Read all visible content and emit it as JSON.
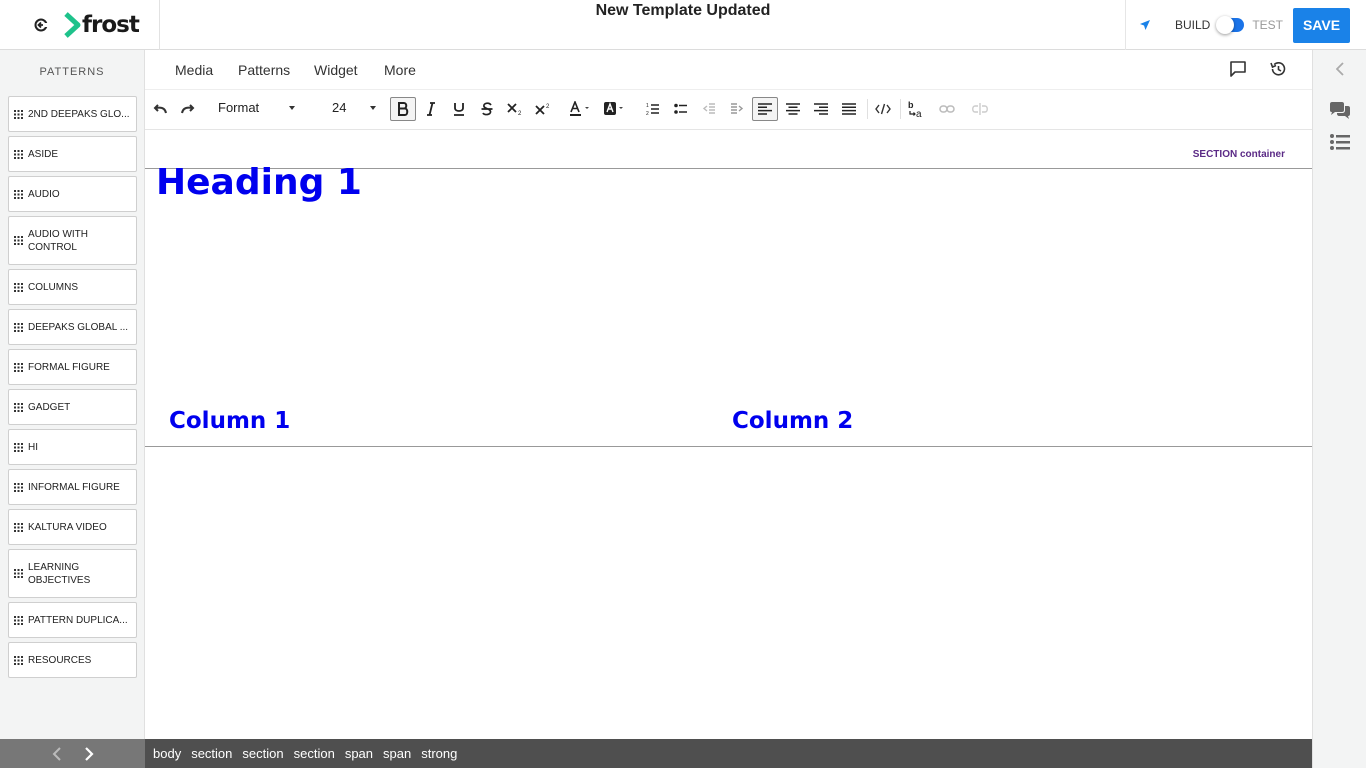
{
  "app": {
    "logo_text": "frost",
    "doc_title": "New Template Updated"
  },
  "topbar": {
    "build_label": "BUILD",
    "test_label": "TEST",
    "save_label": "SAVE"
  },
  "sidebar": {
    "title": "PATTERNS",
    "items": [
      {
        "label": "2ND DEEPAKS GLO..."
      },
      {
        "label": "ASIDE"
      },
      {
        "label": "AUDIO"
      },
      {
        "label": "AUDIO WITH CONTROL"
      },
      {
        "label": "COLUMNS"
      },
      {
        "label": "DEEPAKS GLOBAL ..."
      },
      {
        "label": "FORMAL FIGURE"
      },
      {
        "label": "GADGET"
      },
      {
        "label": "HI"
      },
      {
        "label": "INFORMAL FIGURE"
      },
      {
        "label": "KALTURA VIDEO"
      },
      {
        "label": "LEARNING OBJECTIVES"
      },
      {
        "label": "PATTERN DUPLICA..."
      },
      {
        "label": "RESOURCES"
      }
    ]
  },
  "menubar": {
    "items": [
      "Media",
      "Patterns",
      "Widget",
      "More"
    ]
  },
  "toolbar": {
    "format_label": "Format",
    "font_size": "24"
  },
  "canvas": {
    "section_label": "SECTION container",
    "heading": "Heading 1",
    "column1": "Column 1",
    "column2": "Column 2"
  },
  "statusbar": {
    "crumbs": [
      "body",
      "section",
      "section",
      "section",
      "span",
      "span",
      "strong"
    ]
  },
  "colors": {
    "accent": "#1a82e8",
    "heading_blue": "#0000ee",
    "logo_green": "#1ec28b",
    "section_label": "#5b2a86"
  }
}
